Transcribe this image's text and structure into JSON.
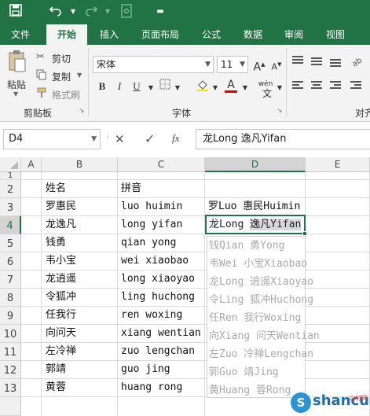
{
  "quick_access": {
    "save_icon": "save-icon",
    "undo_icon": "undo-icon",
    "redo_icon": "redo-icon",
    "touch_icon": "touch-mode-icon",
    "customize_icon": "customize-dropdown-icon"
  },
  "tabs": [
    "文件",
    "开始",
    "插入",
    "页面布局",
    "公式",
    "数据",
    "审阅",
    "视图"
  ],
  "ribbon": {
    "paste_label": "粘贴",
    "cut_label": "剪切",
    "copy_label": "复制",
    "format_painter_label": "格式刷",
    "clipboard_group": "剪贴板",
    "font_name": "宋体",
    "font_size": "11",
    "bold": "B",
    "italic": "I",
    "underline": "U",
    "font_group": "字体",
    "phonetic_label": "wén",
    "align_group": "对齐"
  },
  "formula_bar": {
    "name_box": "D4",
    "cancel": "✕",
    "enter": "✓",
    "fx": "fx",
    "content": "龙Long 逸凡Yifan"
  },
  "columns": [
    "A",
    "B",
    "C",
    "D",
    "E"
  ],
  "rows": [
    "1",
    "2",
    "3",
    "4",
    "5",
    "6",
    "7",
    "8",
    "9",
    "10",
    "11",
    "12",
    "13"
  ],
  "cells": {
    "B2": "姓名",
    "C2": "拼音",
    "B3": "罗惠民",
    "C3": "luo huimin",
    "D3": "罗Luo 惠民Huimin",
    "B4": "龙逸凡",
    "C4": "long yifan",
    "B5": "钱勇",
    "C5": "qian yong",
    "B6": "韦小宝",
    "C6": "wei xiaobao",
    "B7": "龙逍遥",
    "C7": "long xiaoyao",
    "B8": "令狐冲",
    "C8": "ling huchong",
    "B9": "任我行",
    "C9": "ren woxing",
    "B10": "向问天",
    "C10": "xiang wentian",
    "B11": "左冷禅",
    "C11": "zuo lengchan",
    "B12": "郭靖",
    "C12": "guo jing",
    "B13": "黄蓉",
    "C13": "huang rong"
  },
  "active_cell": {
    "ref": "D4",
    "prefix": "龙Long ",
    "selected": "逸凡Yifan"
  },
  "flash_fill_preview": [
    "钱Qian 勇Yong",
    "韦Wei 小宝Xiaobao",
    "龙Long 逍遥Xiaoyao",
    "令Ling 狐冲Huchong",
    "任Ren 我行Woxing",
    "向Xiang 问天Wentian",
    "左Zuo 冷禅Lengchan",
    "郭Guo 靖Jing",
    "黄Huang 蓉Rong"
  ],
  "watermark": {
    "text": "shancun",
    "sub": "山村网",
    "logo": "S"
  },
  "colors": {
    "accent": "#217346"
  }
}
